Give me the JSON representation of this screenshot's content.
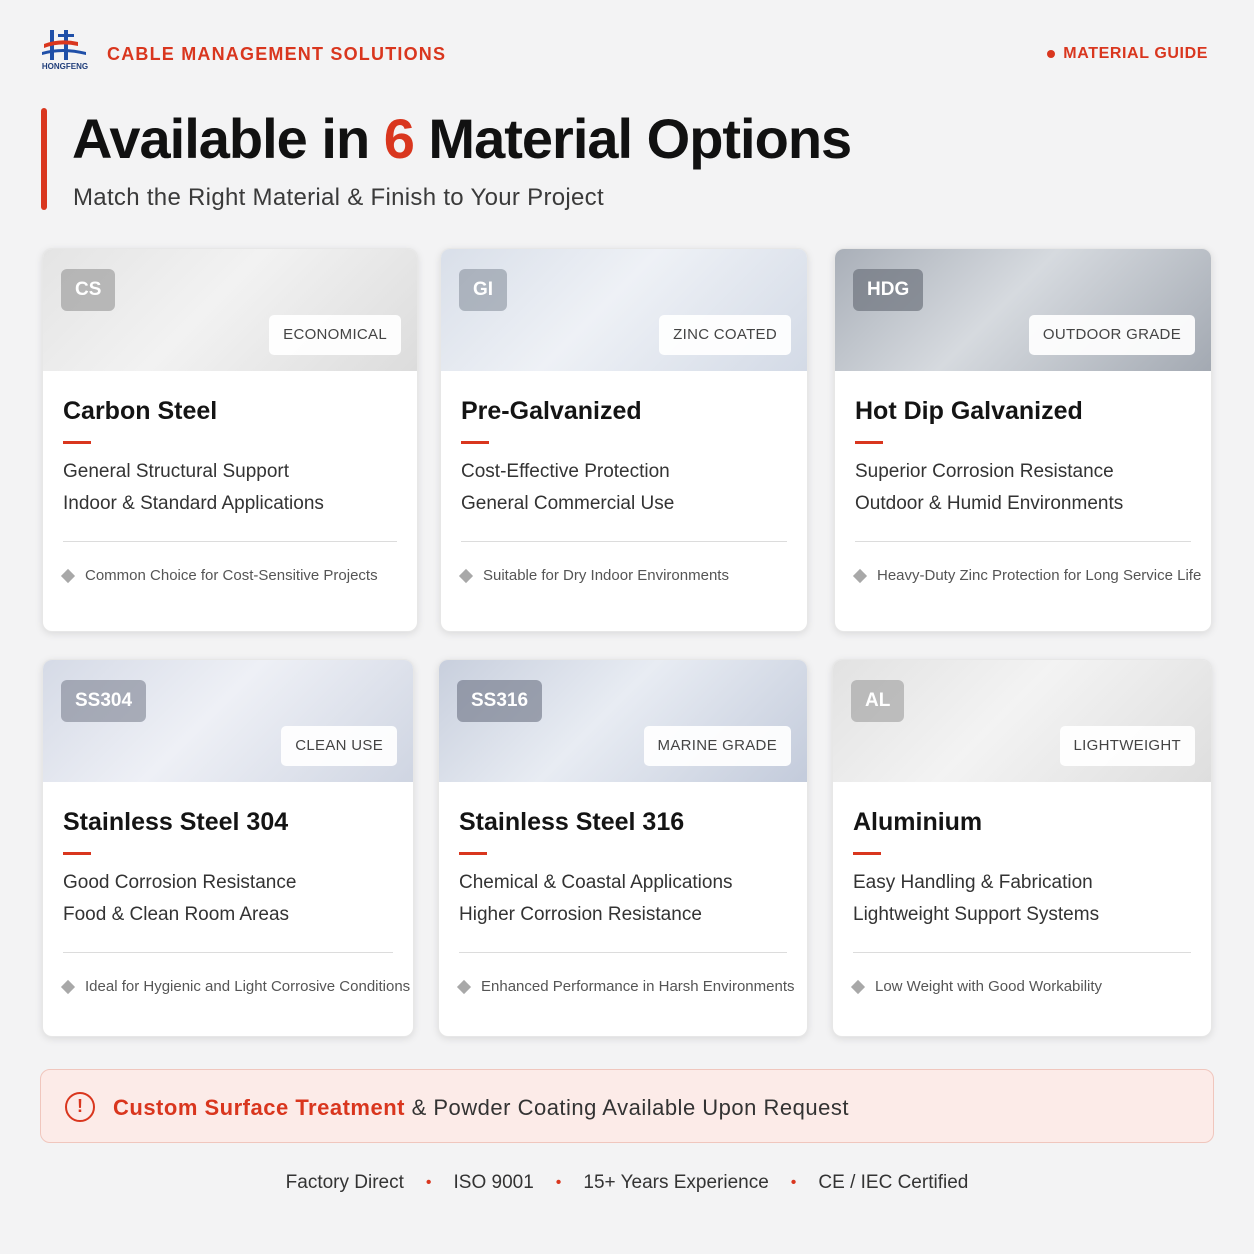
{
  "header": {
    "logo_text": "HONGFENG",
    "brand": "CABLE MANAGEMENT SOLUTIONS",
    "guide_label": "MATERIAL GUIDE"
  },
  "hero": {
    "headline_pre": "Available in ",
    "headline_num": "6",
    "headline_post": " Material Options",
    "subhead": "Match the Right Material & Finish to Your Project"
  },
  "colors": {
    "accent": "#d9361e",
    "background": "#f3f3f4",
    "banner_bg": "#fcebe8"
  },
  "cards": [
    {
      "code": "CS",
      "grade": "ECONOMICAL",
      "title": "Carbon Steel",
      "line1": "General Structural Support",
      "line2": "Indoor & Standard Applications",
      "note": "Common Choice for Cost-Sensitive Projects"
    },
    {
      "code": "GI",
      "grade": "ZINC COATED",
      "title": "Pre-Galvanized",
      "line1": "Cost-Effective Protection",
      "line2": "General Commercial Use",
      "note": "Suitable for Dry Indoor Environments"
    },
    {
      "code": "HDG",
      "grade": "OUTDOOR GRADE",
      "title": "Hot Dip Galvanized",
      "line1": "Superior Corrosion Resistance",
      "line2": "Outdoor & Humid Environments",
      "note": "Heavy-Duty Zinc Protection for Long Service Life"
    },
    {
      "code": "SS304",
      "grade": "CLEAN USE",
      "title": "Stainless Steel 304",
      "line1": "Good Corrosion Resistance",
      "line2": "Food & Clean Room Areas",
      "note": "Ideal for Hygienic and Light Corrosive Conditions"
    },
    {
      "code": "SS316",
      "grade": "MARINE GRADE",
      "title": "Stainless Steel 316",
      "line1": "Chemical & Coastal Applications",
      "line2": "Higher Corrosion Resistance",
      "note": "Enhanced Performance in Harsh Environments"
    },
    {
      "code": "AL",
      "grade": "LIGHTWEIGHT",
      "title": "Aluminium",
      "line1": "Easy Handling & Fabrication",
      "line2": "Lightweight Support Systems",
      "note": "Low Weight with Good Workability"
    }
  ],
  "banner": {
    "icon": "alert-circle-icon",
    "highlight": "Custom Surface Treatment",
    "text": " & Powder Coating Available Upon Request"
  },
  "footer": {
    "items": [
      "Factory Direct",
      "ISO 9001",
      "15+ Years Experience",
      "CE / IEC Certified"
    ],
    "separator": "•"
  }
}
